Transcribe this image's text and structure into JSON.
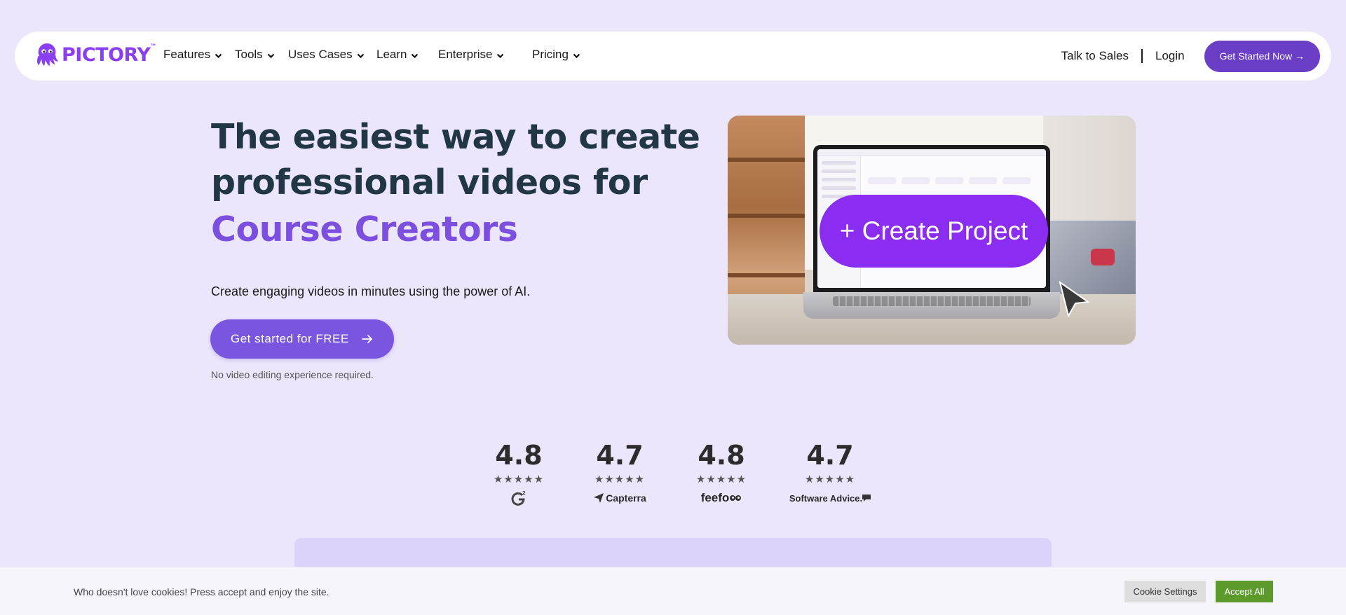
{
  "nav": {
    "brand": "PICTORY",
    "brand_tm": "™",
    "items": [
      {
        "label": "Features"
      },
      {
        "label": "Tools"
      },
      {
        "label": "Uses Cases"
      },
      {
        "label": "Learn"
      },
      {
        "label": "Enterprise"
      },
      {
        "label": "Pricing"
      }
    ],
    "talk_to_sales": "Talk to Sales",
    "login": "Login",
    "cta": "Get Started Now →"
  },
  "hero": {
    "title_line1": "The easiest way to create",
    "title_line2": "professional videos for",
    "title_accent": "Course Creators",
    "subtitle": "Create engaging videos in minutes using the power of AI.",
    "cta": "Get started for FREE",
    "note": "No video editing experience required."
  },
  "video": {
    "button_label": "+ Create Project"
  },
  "ratings": [
    {
      "score": "4.8",
      "stars": "★★★★★",
      "platform_icon": "g2-icon"
    },
    {
      "score": "4.7",
      "stars": "★★★★★",
      "platform": "Capterra"
    },
    {
      "score": "4.8",
      "stars": "★★★★★",
      "platform": "feefo"
    },
    {
      "score": "4.7",
      "stars": "★★★★★",
      "platform": "Software Advice."
    }
  ],
  "cookie": {
    "message": "Who doesn't love cookies! Press accept and enjoy the site.",
    "settings": "Cookie Settings",
    "accept": "Accept All"
  },
  "colors": {
    "background": "#ece6fd",
    "brand_purple": "#8a3ff5",
    "nav_cta": "#6a3fc5",
    "hero_cta": "#7a55e0",
    "accent_text": "#7c4fe0",
    "accept_green": "#5c9a2c"
  }
}
